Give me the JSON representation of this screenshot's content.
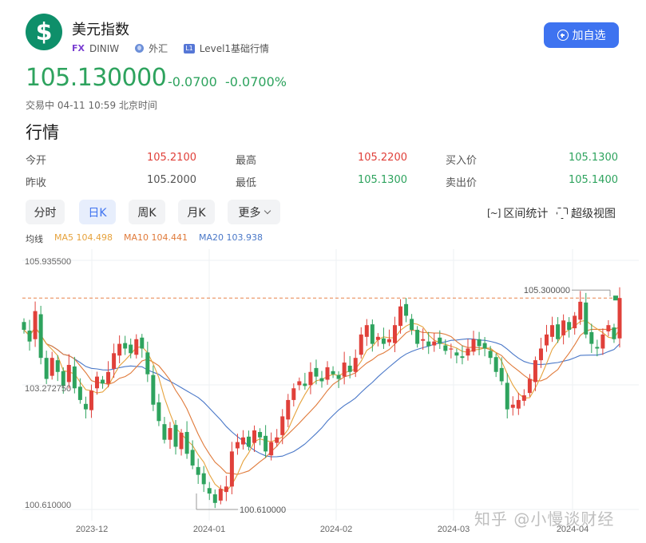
{
  "header": {
    "logo_symbol": "$",
    "name": "美元指数",
    "tag_fx": "FX",
    "code": "DINIW",
    "market": "外汇",
    "tag_l1": "L1",
    "level": "Level1基础行情",
    "follow_label": "加自选"
  },
  "quote": {
    "price": "105.130000",
    "change": "-0.0700",
    "change_pct": "-0.0700%",
    "status": "交易中 04-11 10:59 北京时间"
  },
  "section_title": "行情",
  "stats": [
    {
      "label": "今开",
      "value": "105.2100",
      "tone": "up"
    },
    {
      "label": "最高",
      "value": "105.2200",
      "tone": "up"
    },
    {
      "label": "买入价",
      "value": "105.1300",
      "tone": "down"
    },
    {
      "label": "昨收",
      "value": "105.2000",
      "tone": "neutral"
    },
    {
      "label": "最低",
      "value": "105.1300",
      "tone": "down"
    },
    {
      "label": "卖出价",
      "value": "105.1400",
      "tone": "down"
    }
  ],
  "tabs": [
    {
      "label": "分时",
      "active": false
    },
    {
      "label": "日K",
      "active": true
    },
    {
      "label": "周K",
      "active": false
    },
    {
      "label": "月K",
      "active": false
    },
    {
      "label": "更多",
      "active": false
    }
  ],
  "tools": {
    "range_stats": "区间统计",
    "super_view": "超级视图"
  },
  "ma": {
    "label": "均线",
    "ma5": "MA5 104.498",
    "ma10": "MA10 104.441",
    "ma20": "MA20 103.938"
  },
  "watermark": "知乎 @小慢谈财经",
  "colors": {
    "up": "#e0403a",
    "down": "#2ea35e",
    "accent": "#3e73f0",
    "ma5": "#e6a23c",
    "ma10": "#e07a3a",
    "ma20": "#4a78c8"
  },
  "chart_data": {
    "type": "candlestick",
    "y_axis_labels": [
      "105.935500",
      "103.272750",
      "100.610000"
    ],
    "ylim": [
      100.61,
      105.9355
    ],
    "x_axis_labels": [
      "2023-12",
      "2024-01",
      "2024-02",
      "2024-03",
      "2024-04"
    ],
    "max_annotation": "105.300000",
    "min_annotation": "100.610000",
    "last_price": 105.13,
    "candles_close": [
      104.45,
      104.2,
      104.85,
      103.85,
      103.4,
      103.85,
      103.55,
      103.25,
      103.7,
      103.2,
      102.95,
      102.75,
      103.15,
      103.45,
      103.3,
      103.55,
      103.95,
      104.15,
      104.05,
      103.95,
      104.25,
      104.05,
      103.5,
      102.85,
      102.5,
      102.1,
      102.35,
      101.95,
      102.25,
      101.8,
      101.55,
      101.35,
      101.15,
      100.95,
      100.75,
      101.05,
      101.1,
      101.85,
      102.05,
      102.15,
      101.95,
      102.3,
      102.15,
      101.85,
      102.05,
      102.15,
      102.6,
      102.95,
      103.2,
      103.35,
      103.25,
      103.55,
      103.45,
      103.35,
      103.65,
      103.5,
      103.4,
      103.75,
      103.55,
      103.85,
      104.35,
      104.55,
      104.15,
      104.3,
      104.15,
      104.25,
      104.55,
      104.95,
      104.75,
      104.45,
      104.15,
      104.25,
      104.1,
      104.2,
      104.15,
      104.0,
      104.05,
      103.9,
      103.85,
      104.05,
      104.25,
      104.1,
      104.05,
      103.85,
      103.55,
      103.35,
      102.75,
      102.85,
      102.95,
      103.05,
      103.4,
      103.8,
      104.05,
      104.35,
      104.55,
      104.25,
      104.65,
      104.45,
      104.75,
      105.05,
      104.35,
      104.15,
      104.05,
      104.35,
      104.55,
      104.25,
      105.13
    ],
    "ma5_end": 104.498,
    "ma10_end": 104.441,
    "ma20_end": 103.938
  }
}
